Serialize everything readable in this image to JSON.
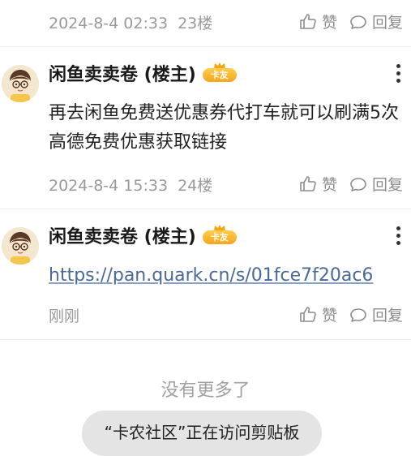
{
  "actions": {
    "like_label": "赞",
    "reply_label": "回复"
  },
  "top_reply": {
    "timestamp": "2024-8-4 02:33",
    "floor": "23楼"
  },
  "replies": [
    {
      "author": "闲鱼卖卖卷 (楼主)",
      "badge": "卡友",
      "content": "再去闲鱼免费送优惠券代打车就可以刷满5次 高德免费优惠获取链接",
      "timestamp": "2024-8-4 15:33",
      "floor": "24楼"
    },
    {
      "author": "闲鱼卖卖卷 (楼主)",
      "badge": "卡友",
      "link": "https://pan.quark.cn/s/01fce7f20ac6",
      "timestamp": "刚刚"
    }
  ],
  "footer": {
    "no_more": "没有更多了"
  },
  "toast": {
    "text": "“卡农社区”正在访问剪贴板"
  },
  "colors": {
    "link": "#4a6a95",
    "badge": "#f3a51b",
    "meta": "#9a9a9a"
  }
}
